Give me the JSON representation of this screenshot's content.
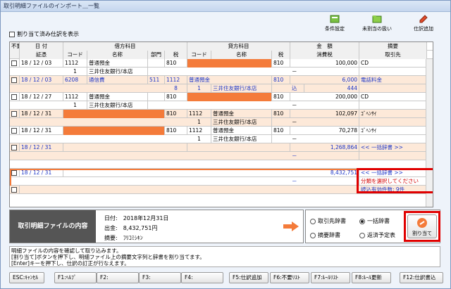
{
  "window": {
    "title": "取引明細ファイルのインポート＿一覧"
  },
  "toolbar": {
    "settings_label": "条件設定",
    "unassigned_label": "未割当の扱い",
    "add_entry_label": "仕訳追加"
  },
  "options": {
    "show_assigned_label": "割り当て済み仕訳を表示"
  },
  "grid": {
    "group_headers": {
      "debit": "借方科目",
      "credit": "貸方科目",
      "amount": "金　額",
      "summary": "摘要"
    },
    "columns": {
      "nonneed": "不要",
      "date": "日 付",
      "voucher": "証憑",
      "code": "コード",
      "name": "名称",
      "dept": "部門",
      "tax": "税",
      "amount_tax": "消費税",
      "partner": "取引先"
    },
    "rows": [
      {
        "date": "18 / 12 / 03",
        "dcode": "1112",
        "dname": "普通預金",
        "dtax": "810",
        "ctax": "810",
        "amount": "100,000",
        "summary": "CD"
      },
      {
        "dcode": "1",
        "dname": "三井住友銀行/本店",
        "mark": "－"
      },
      {
        "date": "18 / 12 / 03",
        "dcode": "6208",
        "dname": "通信費",
        "ddept": "511",
        "dtax": "1112",
        "ccode": "普通預金",
        "ctax": "810",
        "amount": "6,000",
        "summary": "電話料金"
      },
      {
        "dtax": "8",
        "ccode2": "1",
        "cname2": "三井住友銀行/本店",
        "mark": "込",
        "amount_tax": "444"
      },
      {
        "date": "18 / 12 / 27",
        "dcode": "1112",
        "dname": "普通預金",
        "dtax": "810",
        "ctax": "810",
        "amount": "200,000",
        "summary": "CD"
      },
      {
        "dcode": "1",
        "dname": "三井住友銀行/本店",
        "mark": "－"
      },
      {
        "date": "18 / 12 / 31",
        "dtax": "810",
        "ccode": "1112",
        "cname": "普通預金",
        "ctax": "810",
        "amount": "102,097",
        "summary": "ｺﾞﾍﾝｻｲ"
      },
      {
        "ccode": "1",
        "cname": "三井住友銀行/本店",
        "mark": "－"
      },
      {
        "date": "18 / 12 / 31",
        "dtax": "810",
        "ccode": "1112",
        "cname": "普通預金",
        "ctax": "810",
        "amount": "70,278",
        "summary": "ｺﾞﾍﾝｻｲ"
      },
      {
        "ccode": "1",
        "cname": "三井住友銀行/本店",
        "mark": "－"
      },
      {
        "date": "18 / 12 / 31",
        "amount": "1,268,864",
        "summary": "<< 一括辞書 >>"
      },
      {
        "mark": "－"
      },
      {
        "date": "18 / 12 / 31",
        "amount": "8,432,751",
        "summary": "<< 一括辞書 >>"
      },
      {
        "mark": "－",
        "summary": "分類を選択してください"
      },
      {
        "summary": "読込有効件数: 9件"
      }
    ]
  },
  "info": {
    "label": "取引明細ファイルの内容",
    "date_label": "日付:",
    "date_value": "2018年12月31日",
    "out_label": "出金:",
    "out_value": "8,432,751円",
    "memo_label": "摘要:",
    "memo_value": "ﾌﾘｺﾐｼｷﾝ"
  },
  "dict": {
    "partner_dict": "取引先辞書",
    "bulk_dict": "一括辞書",
    "summary_dict": "摘要辞書",
    "refund": "返済予定表",
    "apply_label": "割り当て"
  },
  "message": [
    "明細ファイルの内容を確認して取り込みます。",
    "[割り当て]ボタンを押下し、明細ファイル上の摘要文字列と辞書を割り当てます。",
    "[Enter]キーを押下し、仕訳の訂正が行なえます。"
  ],
  "fkeys": [
    "ESC:ｷｬﾝｾﾙ",
    "F1:ﾍﾙﾌﾟ",
    "F2:",
    "F3:",
    "F4:",
    "F5:仕訳追加",
    "F6:不要ﾘｽﾄ",
    "F7:ﾙｰﾙﾘｽﾄ",
    "F8:ﾙｰﾙ更新",
    "F12:仕訳書込"
  ],
  "colors": {
    "accent_orange": "#f47b3a",
    "highlight_red": "#e00000",
    "peach": "#fde9d9",
    "link_blue": "#1a35c8"
  }
}
